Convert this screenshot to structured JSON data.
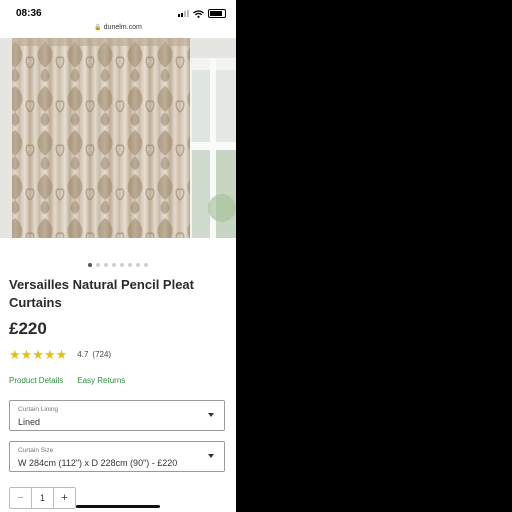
{
  "status": {
    "time": "08:36"
  },
  "browser": {
    "url": "dunelm.com"
  },
  "gallery": {
    "slides": 8,
    "active_index": 0
  },
  "product": {
    "title": "Versailles Natural Pencil Pleat Curtains",
    "price": "£220",
    "rating": {
      "stars": "★★★★★",
      "value": "4.7",
      "count": "(724)",
      "score_of_5": 4.7
    },
    "links": [
      "Product Details",
      "Easy Returns"
    ]
  },
  "lining_select": {
    "label": "Curtain Lining",
    "value": "Lined"
  },
  "size_select": {
    "label": "Curtain Size",
    "value": "W 284cm (112\") x D 228cm (90\") - £220"
  },
  "quantity": {
    "minus": "−",
    "value": "1",
    "plus": "+"
  },
  "icons": [
    "signal-icon",
    "wifi-icon",
    "battery-icon",
    "lock-icon",
    "chevron-down-icon",
    "minus-icon",
    "plus-icon"
  ],
  "colors": {
    "link": "#2e8f3e",
    "star": "#e2bf1c",
    "text": "#2b2b2b"
  }
}
